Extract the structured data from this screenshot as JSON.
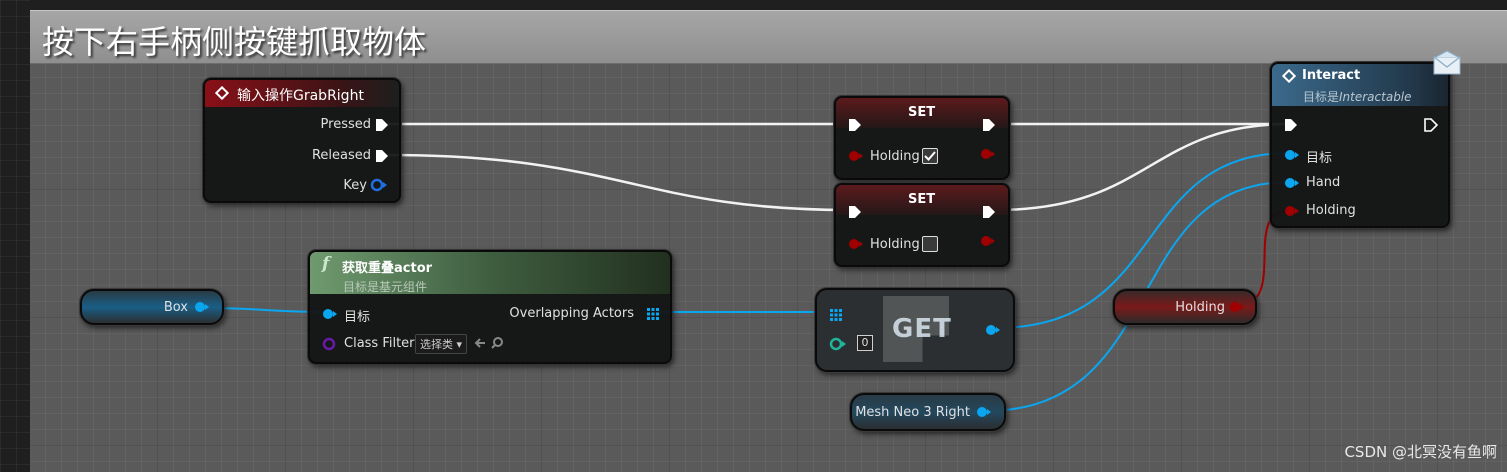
{
  "comment": {
    "title": "按下右手柄侧按键抓取物体"
  },
  "input_node": {
    "title": "输入操作GrabRight",
    "pins": {
      "pressed": "Pressed",
      "released": "Released",
      "key": "Key"
    }
  },
  "set_node_1": {
    "title": "SET",
    "pin": "Holding",
    "checked": true
  },
  "set_node_2": {
    "title": "SET",
    "pin": "Holding",
    "checked": false
  },
  "interact_node": {
    "title": "Interact",
    "subtitle_prefix": "目标是",
    "subtitle_class": "Interactable",
    "pins": {
      "target": "目标",
      "hand": "Hand",
      "holding": "Holding"
    }
  },
  "overlap_node": {
    "title": "获取重叠actor",
    "subtitle": "目标是基元组件",
    "pins": {
      "target": "目标",
      "class_filter": "Class Filter",
      "overlapping": "Overlapping Actors"
    },
    "dropdown_value": "选择类"
  },
  "box_node": {
    "label": "Box"
  },
  "get_node": {
    "title": "GET",
    "index": "0"
  },
  "holding_var": {
    "label": "Holding"
  },
  "mesh_node": {
    "label": "Mesh Neo 3 Right"
  },
  "watermark": "CSDN @北冥没有鱼啊",
  "colors": {
    "exec": "#ffffff",
    "object": "#0aa6f0",
    "bool": "#a00000",
    "class": "#6a1aa8",
    "struct": "#1f9aa0",
    "input_header": "#7a0f14",
    "function_header": "#3f6a3f",
    "interact_header": "#2b4f6a"
  }
}
